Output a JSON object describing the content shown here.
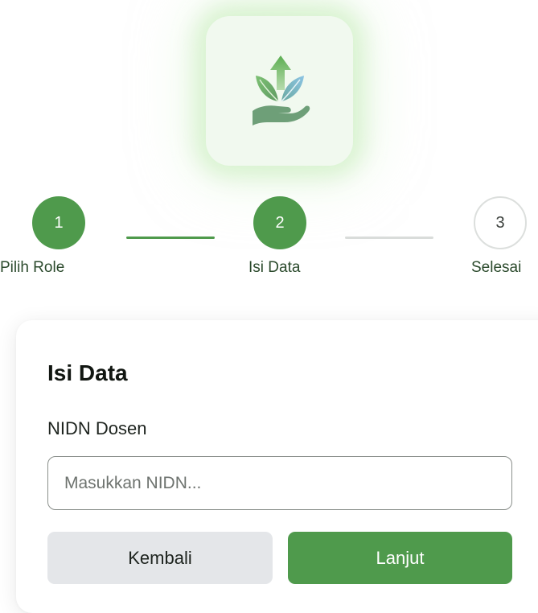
{
  "logo": {
    "icon": "hand-with-sprouting-plant-and-up-arrow-icon"
  },
  "stepper": {
    "steps": [
      {
        "number": "1",
        "label": "Pilih Role",
        "state": "completed"
      },
      {
        "number": "2",
        "label": "Isi Data",
        "state": "current"
      },
      {
        "number": "3",
        "label": "Selesai",
        "state": "pending"
      }
    ]
  },
  "form": {
    "title": "Isi Data",
    "nidn_label": "NIDN Dosen",
    "nidn_value": "",
    "nidn_placeholder": "Masukkan NIDN...",
    "back_label": "Kembali",
    "next_label": "Lanjut"
  },
  "colors": {
    "primary": "#4f9a4c",
    "secondary_button": "#e4e6e9",
    "inactive_step": "#dcdfdd"
  }
}
